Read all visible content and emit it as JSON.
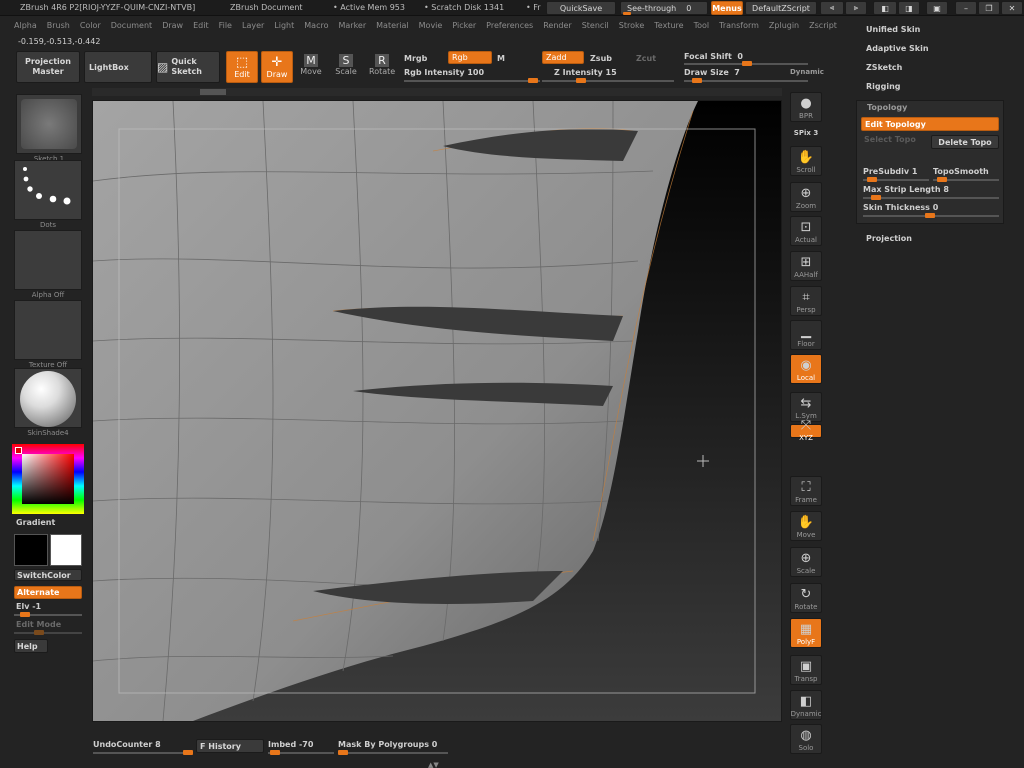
{
  "title_bar": {
    "app_title": "ZBrush 4R6 P2[RIOJ-YYZF-QUIM-CNZI-NTVB]",
    "document": "ZBrush Document",
    "active_mem": "• Active Mem 953",
    "scratch_disk": "• Scratch Disk 1341",
    "trailing": "• Fr",
    "quicksave": "QuickSave",
    "see_through": "See-through",
    "see_through_value": "0",
    "menus": "Menus",
    "default_script": "DefaultZScript"
  },
  "menu_bar": [
    "Alpha",
    "Brush",
    "Color",
    "Document",
    "Draw",
    "Edit",
    "File",
    "Layer",
    "Light",
    "Macro",
    "Marker",
    "Material",
    "Movie",
    "Picker",
    "Preferences",
    "Render",
    "Stencil",
    "Stroke",
    "Texture",
    "Tool",
    "Transform",
    "Zplugin",
    "Zscript"
  ],
  "coords": "-0.159,-0.513,-0.442",
  "toolbar": {
    "projection_master": "Projection Master",
    "lightbox": "LightBox",
    "quick_sketch": "Quick Sketch",
    "edit": "Edit",
    "draw": "Draw",
    "move": "Move",
    "scale": "Scale",
    "rotate": "Rotate",
    "mrgb": "Mrgb",
    "rgb": "Rgb",
    "m": "M",
    "rgb_intensity": "Rgb Intensity 100",
    "zadd": "Zadd",
    "zsub": "Zsub",
    "zcut": "Zcut",
    "z_intensity": "Z Intensity 15",
    "focal_shift": "Focal Shift",
    "focal_shift_value": "0",
    "draw_size": "Draw Size",
    "draw_size_value": "7",
    "dynamic": "Dynamic"
  },
  "left_panel": {
    "sketch": "Sketch 1",
    "dots": "Dots",
    "alpha": "Alpha Off",
    "texture": "Texture Off",
    "material": "SkinShade4",
    "gradient": "Gradient",
    "switch_color": "SwitchColor",
    "alternate": "Alternate",
    "elv": "Elv -1",
    "edit_mode": "Edit Mode",
    "help": "Help",
    "primary_color": "#000000",
    "secondary_color": "#ffffff"
  },
  "right_tools": [
    {
      "label": "BPR",
      "icon": "bpr-sphere-icon"
    },
    {
      "label": "SPix 3",
      "icon": "spix-icon"
    },
    {
      "label": "Scroll",
      "icon": "scroll-icon"
    },
    {
      "label": "Zoom",
      "icon": "zoom-icon"
    },
    {
      "label": "Actual",
      "icon": "actual-icon"
    },
    {
      "label": "AAHalf",
      "icon": "aahalf-icon"
    },
    {
      "label": "Persp",
      "icon": "persp-icon"
    },
    {
      "label": "Floor",
      "icon": "floor-icon"
    },
    {
      "label": "Local",
      "icon": "local-icon"
    },
    {
      "label": "L.Sym",
      "icon": "lsym-icon"
    },
    {
      "label": "XYZ",
      "icon": "xyz-icon"
    },
    {
      "label": "Frame",
      "icon": "frame-icon"
    },
    {
      "label": "Move",
      "icon": "move-icon"
    },
    {
      "label": "Scale",
      "icon": "scale-icon"
    },
    {
      "label": "Rotate",
      "icon": "rotate-icon"
    },
    {
      "label": "PolyF",
      "icon": "polyf-icon"
    },
    {
      "label": "Transp",
      "icon": "transp-icon"
    },
    {
      "label": "Dynamic",
      "icon": "dynamic-icon"
    },
    {
      "label": "Solo",
      "icon": "solo-icon"
    }
  ],
  "tool_palette": {
    "unified_skin": "Unified Skin",
    "adaptive_skin": "Adaptive Skin",
    "zsketch": "ZSketch",
    "rigging": "Rigging",
    "topology_header": "Topology",
    "edit_topology": "Edit Topology",
    "select_topo": "Select Topo",
    "delete_topo": "Delete Topo",
    "presubdiv": "PreSubdiv 1",
    "topo_smooth": "TopoSmooth",
    "max_strip_length": "Max Strip Length 8",
    "skin_thickness": "Skin Thickness 0",
    "projection": "Projection"
  },
  "bottom_bar": {
    "undo_counter": "UndoCounter 8",
    "f_history": "F History",
    "imbed": "Imbed -70",
    "mask_by_polygroups": "Mask By Polygroups 0"
  },
  "colors": {
    "accent": "#e8761a",
    "background": "#232323",
    "canvas": "#3a3a3a"
  }
}
